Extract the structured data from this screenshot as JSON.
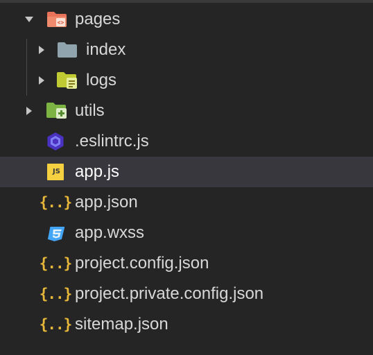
{
  "tree": {
    "items": [
      {
        "label": "pages",
        "icon": "folder-pages-open-icon",
        "expanded": true,
        "type": "folder"
      },
      {
        "label": "index",
        "icon": "folder-icon",
        "expanded": false,
        "type": "folder"
      },
      {
        "label": "logs",
        "icon": "folder-logs-icon",
        "expanded": false,
        "type": "folder"
      },
      {
        "label": "utils",
        "icon": "folder-utils-icon",
        "expanded": false,
        "type": "folder"
      },
      {
        "label": ".eslintrc.js",
        "icon": "eslint-icon",
        "type": "file"
      },
      {
        "label": "app.js",
        "icon": "js-file-icon",
        "type": "file",
        "selected": true
      },
      {
        "label": "app.json",
        "icon": "json-file-icon",
        "type": "file"
      },
      {
        "label": "app.wxss",
        "icon": "css-file-icon",
        "type": "file"
      },
      {
        "label": "project.config.json",
        "icon": "json-file-icon",
        "type": "file"
      },
      {
        "label": "project.private.config.json",
        "icon": "json-file-icon",
        "type": "file"
      },
      {
        "label": "sitemap.json",
        "icon": "json-file-icon",
        "type": "file"
      }
    ],
    "js_badge": "JS",
    "json_glyph": "{..}"
  },
  "colors": {
    "background": "#252526",
    "selected_row": "#37373d",
    "text": "#d8d8d8",
    "folder_pages": "#e8735a",
    "folder_default": "#90a4ae",
    "folder_logs": "#c0ca33",
    "folder_utils": "#7cb342",
    "eslint": "#4b32c3",
    "js": "#f5d142",
    "json": "#e8b83a",
    "css": "#42a5f5"
  }
}
